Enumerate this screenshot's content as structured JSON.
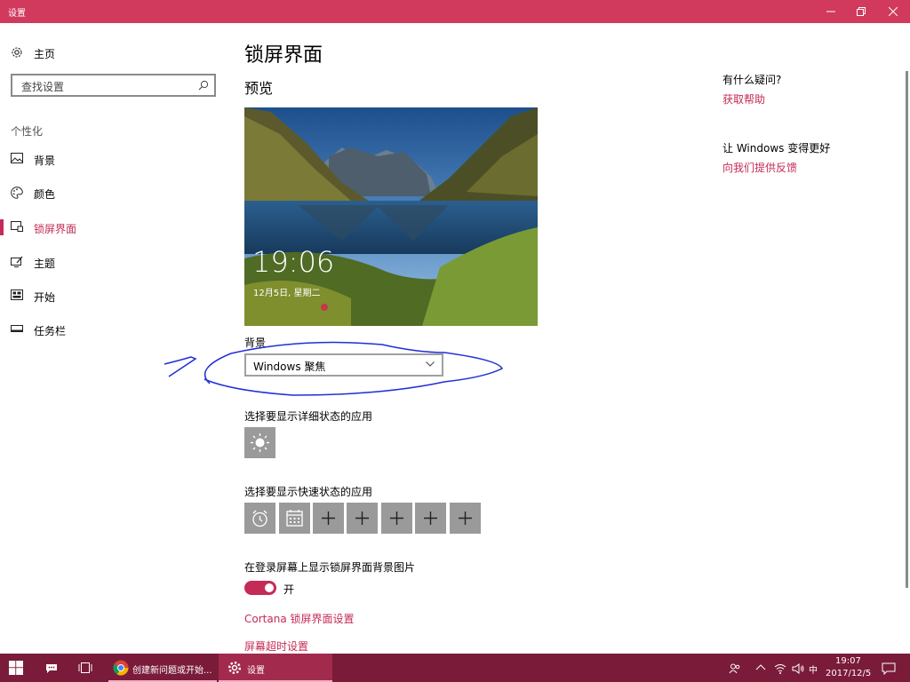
{
  "window": {
    "title": "设置"
  },
  "sidebar": {
    "home_label": "主页",
    "search_placeholder": "查找设置",
    "section_label": "个性化",
    "items": [
      {
        "label": "背景",
        "icon": "picture-icon",
        "active": false
      },
      {
        "label": "颜色",
        "icon": "palette-icon",
        "active": false
      },
      {
        "label": "锁屏界面",
        "icon": "lock-screen-icon",
        "active": true
      },
      {
        "label": "主题",
        "icon": "theme-icon",
        "active": false
      },
      {
        "label": "开始",
        "icon": "start-icon",
        "active": false
      },
      {
        "label": "任务栏",
        "icon": "taskbar-icon",
        "active": false
      }
    ]
  },
  "main": {
    "title": "锁屏界面",
    "preview_label": "预览",
    "preview_time": "19:06",
    "preview_date": "12月5日, 星期二",
    "background_label": "背景",
    "background_value": "Windows 聚焦",
    "detailed_status_label": "选择要显示详细状态的应用",
    "detailed_status_app": "weather-icon",
    "quick_status_label": "选择要显示快速状态的应用",
    "quick_status_apps": [
      "alarm-icon",
      "calendar-icon",
      "plus-icon",
      "plus-icon",
      "plus-icon",
      "plus-icon",
      "plus-icon"
    ],
    "login_bg_label": "在登录屏幕上显示锁屏界面背景图片",
    "login_bg_toggle": "开",
    "cortana_link": "Cortana 锁屏界面设置",
    "timeout_link": "屏幕超时设置"
  },
  "right": {
    "help_question": "有什么疑问?",
    "help_link": "获取帮助",
    "feedback_question": "让 Windows 变得更好",
    "feedback_link": "向我们提供反馈"
  },
  "taskbar": {
    "chrome_label": "创建新问题或开始...",
    "settings_label": "设置",
    "ime": "中",
    "time": "19:07",
    "date": "2017/12/5"
  },
  "colors": {
    "accent": "#c42b56",
    "titlebar": "#d13a5c",
    "taskbar": "#7a1b3a",
    "tile": "#9a9a9a",
    "annotation": "#1f2fd6"
  }
}
